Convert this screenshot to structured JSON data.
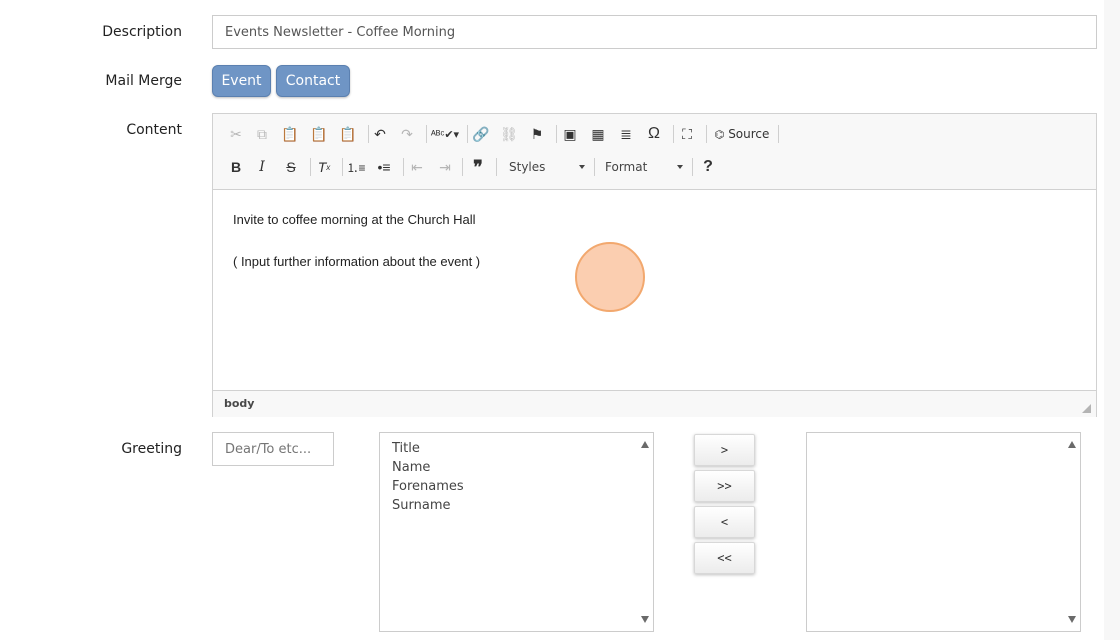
{
  "form": {
    "description_label": "Description",
    "description_value": "Events Newsletter - Coffee Morning",
    "mail_merge_label": "Mail Merge",
    "mail_merge_buttons": [
      "Event",
      "Contact"
    ],
    "content_label": "Content",
    "greeting_label": "Greeting",
    "greeting_placeholder": "Dear/To etc..."
  },
  "editor": {
    "toolbar": {
      "source_label": "Source",
      "styles_label": "Styles",
      "format_label": "Format",
      "help_label": "?"
    },
    "content_lines": [
      "Invite to coffee morning at the Church Hall",
      "( Input further information about the event )"
    ],
    "status_path": "body"
  },
  "fields": {
    "available": [
      "Title",
      "Name",
      "Forenames",
      "Surname"
    ],
    "selected": []
  },
  "move_buttons": {
    "add": ">",
    "add_all": ">>",
    "remove": "<",
    "remove_all": "<<"
  }
}
